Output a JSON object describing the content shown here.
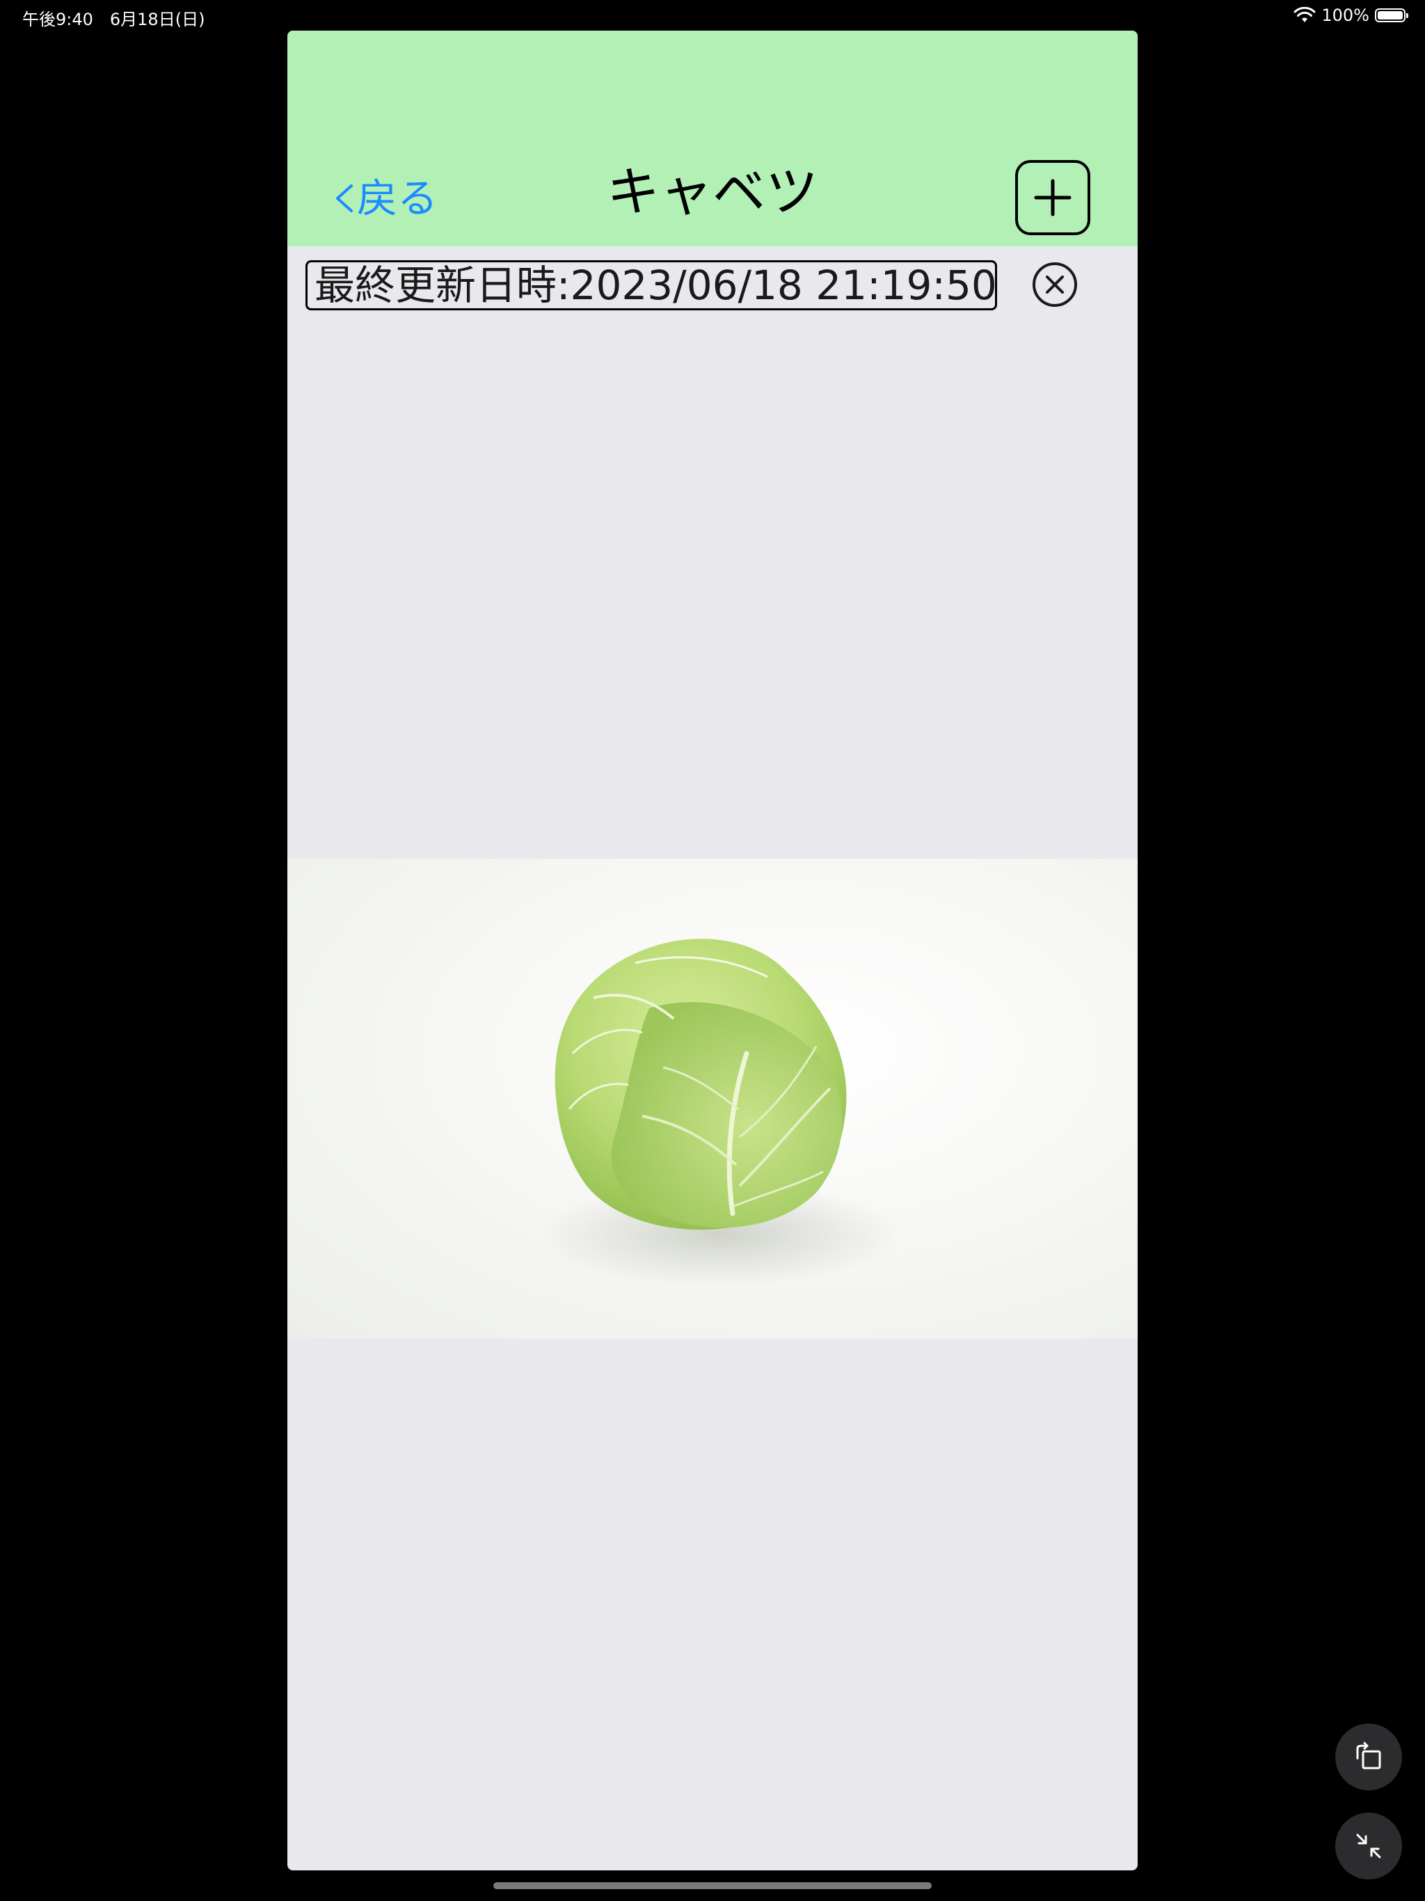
{
  "status_bar": {
    "time_date": "午後9:40　6月18日(日)",
    "battery_text": "100%",
    "battery_level": 1.0,
    "wifi_icon": "wifi-icon",
    "battery_icon": "battery-icon"
  },
  "nav": {
    "back_label": "戻る",
    "title": "キャベツ",
    "add_icon": "plus-icon",
    "background_color": "#b2f0b6",
    "back_color": "#1a8cff"
  },
  "record": {
    "last_updated": "最終更新日時:2023/06/18 21:19:50",
    "clear_icon": "x-circle-icon"
  },
  "photo": {
    "subject": "cabbage-photo"
  },
  "floating_buttons": {
    "rotate_icon": "rotate-icon",
    "shrink_icon": "collapse-icon"
  }
}
